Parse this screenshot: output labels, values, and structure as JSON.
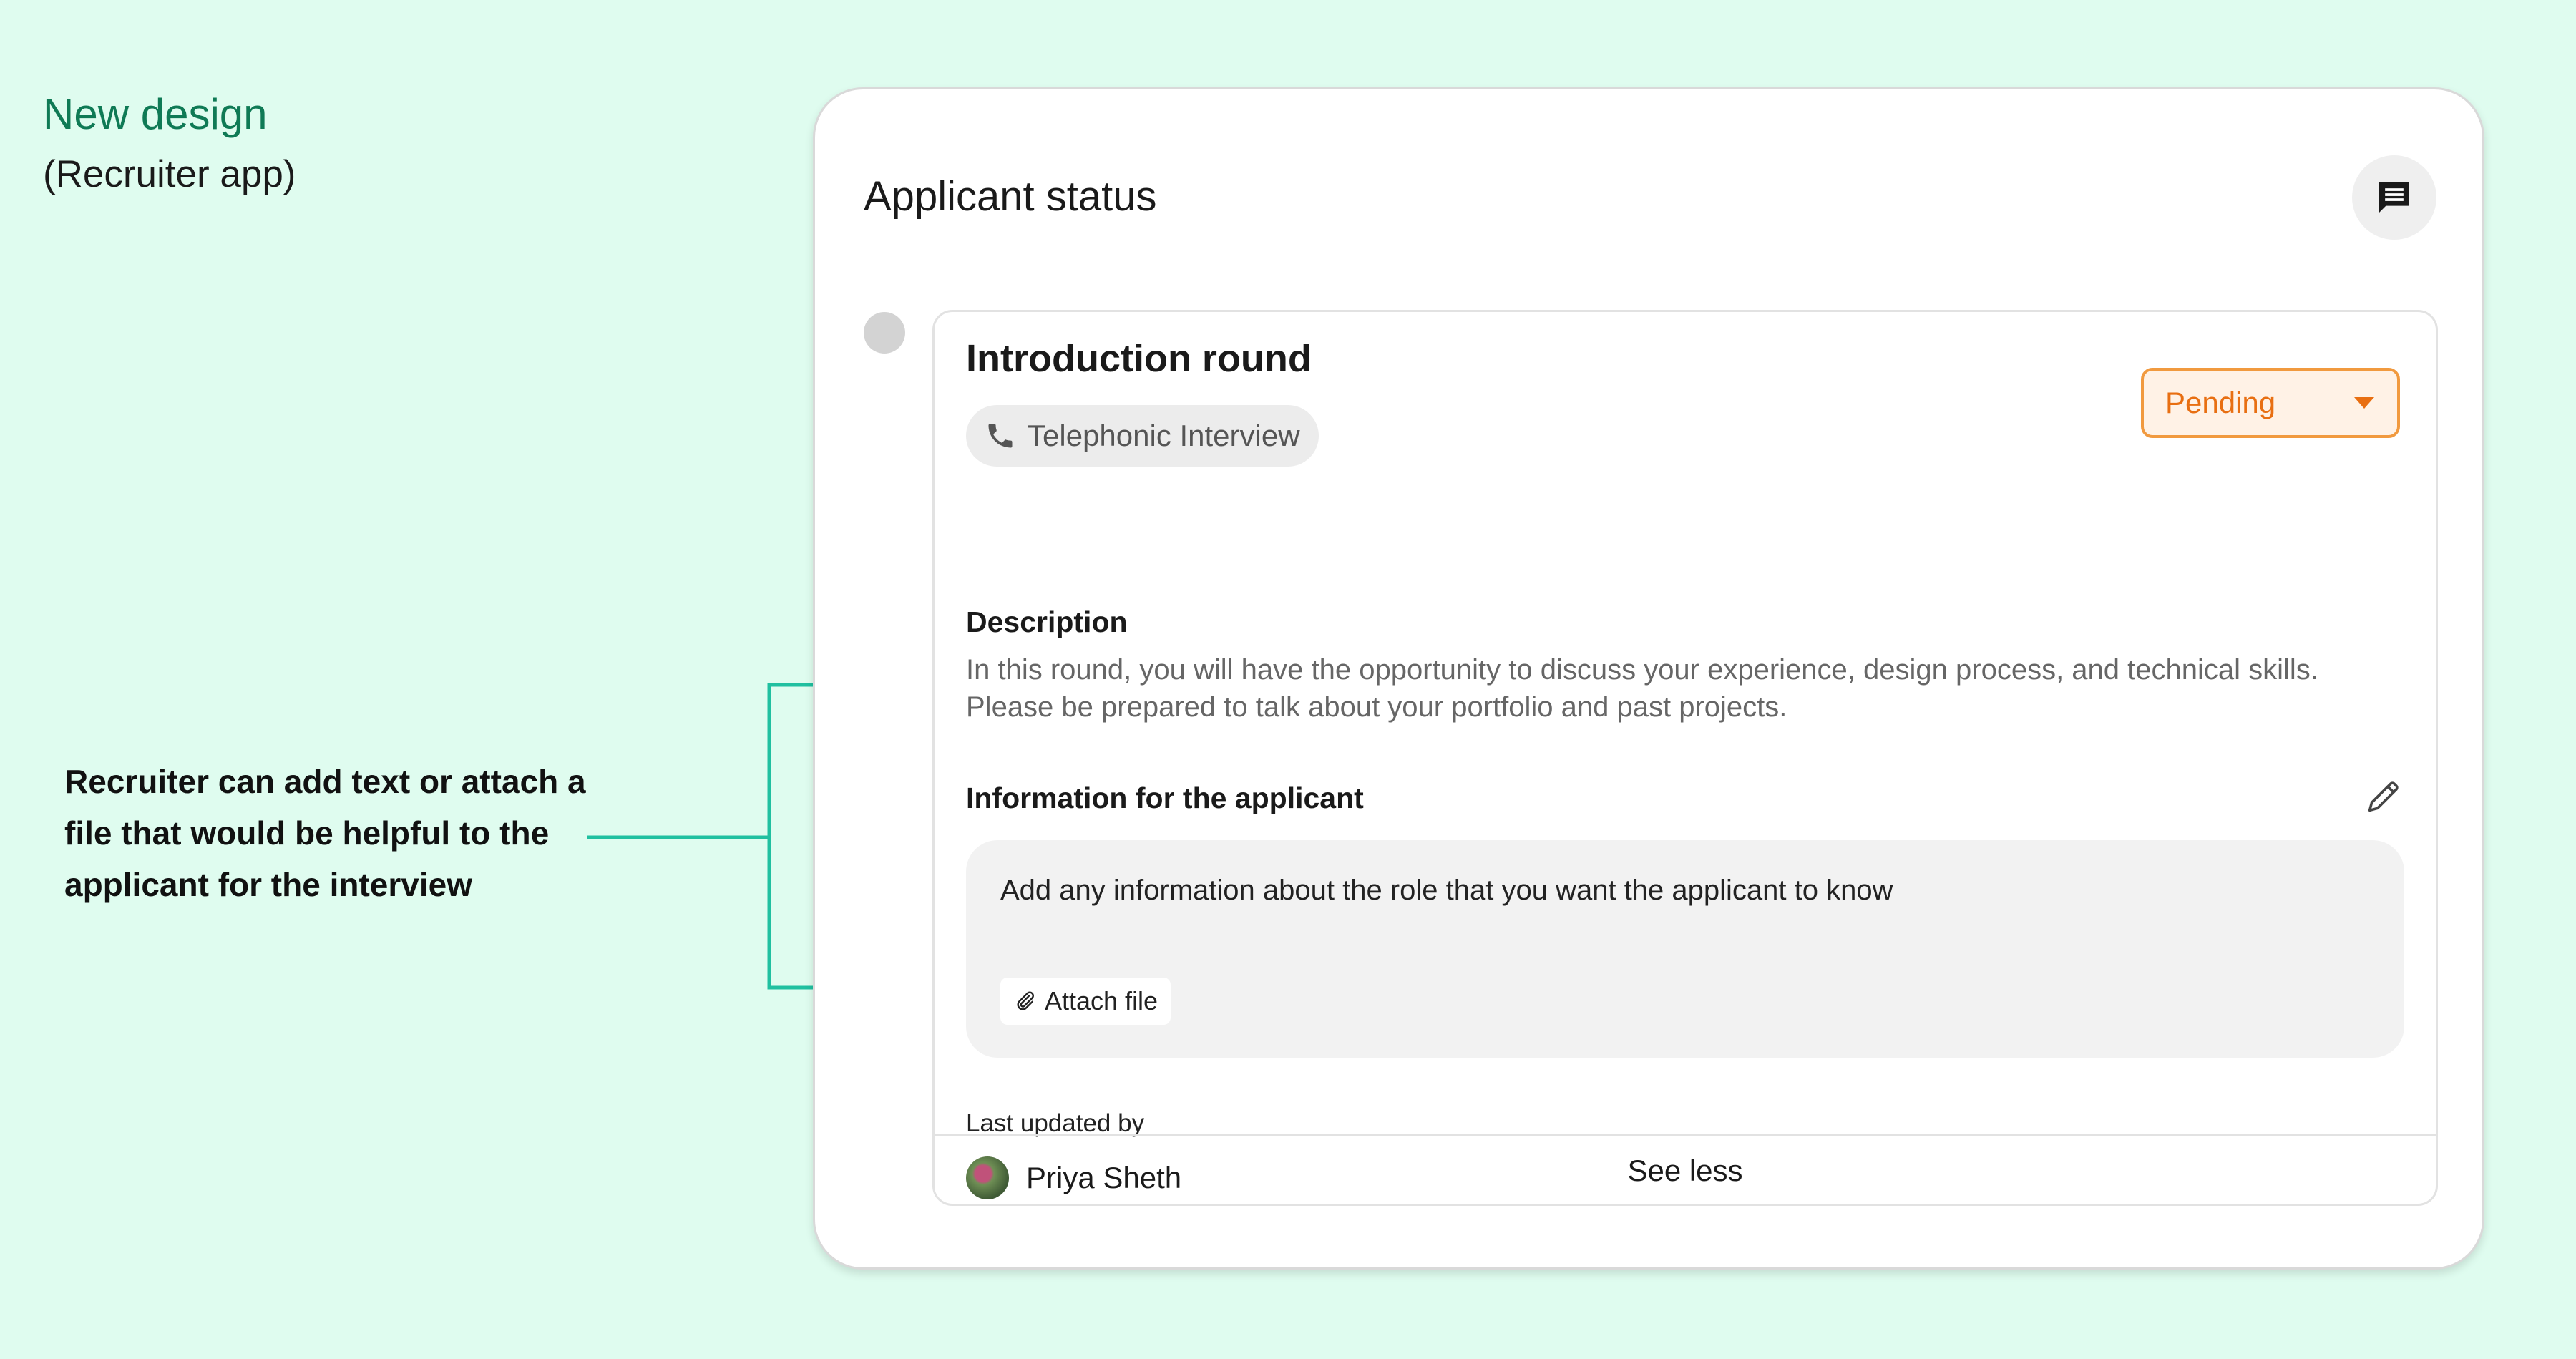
{
  "page": {
    "title": "New design",
    "subtitle": "(Recruiter app)",
    "annotation": "Recruiter can add text or attach a file that would be helpful to the applicant for the interview"
  },
  "card": {
    "title": "Applicant status",
    "chat_icon": "chat-icon"
  },
  "round": {
    "title": "Introduction round",
    "type_icon": "phone-icon",
    "type_label": "Telephonic Interview",
    "status": "Pending",
    "status_icon": "caret-down-icon",
    "description_label": "Description",
    "description_text": "In this round, you will have the opportunity to discuss your experience, design process, and technical skills. Please be prepared to talk about your portfolio and past projects.",
    "info_label": "Information for the applicant",
    "edit_icon": "pencil-icon",
    "info_placeholder": "Add any information about the role that you want the applicant to know",
    "attach_icon": "paperclip-icon",
    "attach_label": "Attach file",
    "last_updated_label": "Last updated by",
    "updated_by": "Priya Sheth",
    "see_less": "See less"
  },
  "colors": {
    "background": "#dffcef",
    "title_green": "#0f7a55",
    "bracket_teal": "#20c0a0",
    "pending_orange": "#e86f12",
    "pending_bg": "#fff2e6"
  }
}
